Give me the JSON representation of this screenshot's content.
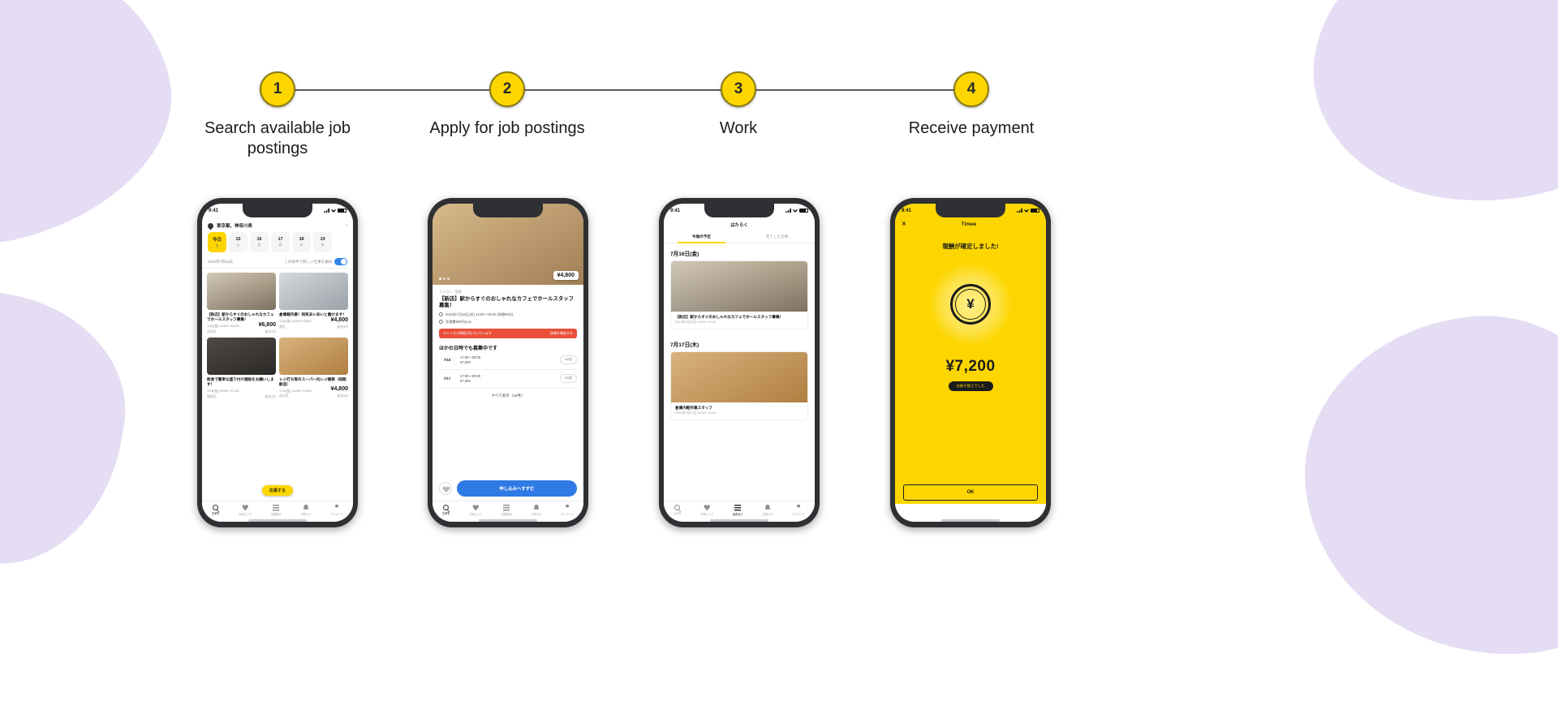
{
  "theme": {
    "accent_yellow": "#fdd600",
    "blob_purple": "#e5ddf3",
    "line_gray": "#5d5d5d",
    "cta_blue": "#2f7ae5",
    "alert_red": "#e8503a"
  },
  "stepper": {
    "steps": [
      {
        "number": "1",
        "label": "Search available job postings"
      },
      {
        "number": "2",
        "label": "Apply for job postings"
      },
      {
        "number": "3",
        "label": "Work"
      },
      {
        "number": "4",
        "label": "Receive payment"
      }
    ]
  },
  "phones": [
    {
      "name": "search-screen",
      "status": {
        "time": "9:41"
      },
      "location": "東京都、神奈川県",
      "dates": [
        {
          "day": "今日",
          "weekday": "金"
        },
        {
          "day": "15",
          "weekday": "土"
        },
        {
          "day": "16",
          "weekday": "日"
        },
        {
          "day": "17",
          "weekday": "月"
        },
        {
          "day": "18",
          "weekday": "火"
        },
        {
          "day": "19",
          "weekday": "水"
        }
      ],
      "filter_label": "2022年7月16日",
      "toggle_label": "この条件で新しい仕事を通知",
      "cards": [
        {
          "title": "【新店】駅からすぐのおしゃれなカフェでホールスタッフ募集！",
          "time": "7/16(金)\n10:00〜18:00",
          "pay": "¥6,800",
          "place": "渋谷区",
          "dist": "徒歩3分"
        },
        {
          "title": "倉庫軽作業！和気あいあいと働けます！",
          "time": "7/16(金)\n10:00〜18:00",
          "pay": "¥4,800",
          "place": "港区",
          "dist": "徒歩5分"
        },
        {
          "title": "飲食で簡単な盛り付け補助をお願いします！",
          "time": "7/16(金)\n09:00〜17:00",
          "pay": "",
          "place": "新宿区",
          "dist": "徒歩2分"
        },
        {
          "title": "レジ打ち等のスーパー内レジ業務（短期歓迎）",
          "time": "7/16(金)\n13:00〜19:00",
          "pay": "¥4,800",
          "place": "品川区",
          "dist": "徒歩8分"
        }
      ],
      "apply_pill": "応募する",
      "tabs": [
        {
          "icon": "search-icon",
          "label": "さがす",
          "active": true
        },
        {
          "icon": "heart-icon",
          "label": "お気に入り",
          "active": false
        },
        {
          "icon": "list-icon",
          "label": "応募済み",
          "active": false
        },
        {
          "icon": "bell-icon",
          "label": "お知らせ",
          "active": false
        },
        {
          "icon": "user-icon",
          "label": "マイページ",
          "active": false
        }
      ]
    },
    {
      "name": "job-detail-screen",
      "status": {
        "time": "9:41"
      },
      "hero_pay_badge": "¥4,800",
      "category": "カテゴリ：飲食",
      "title": "【新店】駅からすぐのおしゃれなカフェでホールスタッフ募集！",
      "meta_date": "2022年7月16日(金) 13:00〜19:00 (休憩60分)",
      "meta_place": "交通費500円込み",
      "alert_text": "キャンセル期限が近づいています",
      "alert_action": "詳細を確認する",
      "section_title": "ほかの日時でも募集中です",
      "slots": [
        {
          "date": "7/16",
          "weekday": "金",
          "time": "17:00〜20:00",
          "pay": "¥7,500",
          "capacity": "1/5名"
        },
        {
          "date": "7/17",
          "weekday": "土",
          "time": "17:00〜20:00",
          "pay": "¥7,500",
          "capacity": "2/5名"
        }
      ],
      "more_label": "すべて表示（16件）",
      "cta_label": "申し込みへすすむ",
      "fav_icon": "heart-icon",
      "tabs": [
        {
          "icon": "search-icon",
          "label": "さがす",
          "active": true
        },
        {
          "icon": "heart-icon",
          "label": "お気に入り",
          "active": false
        },
        {
          "icon": "list-icon",
          "label": "応募済み",
          "active": false
        },
        {
          "icon": "bell-icon",
          "label": "お知らせ",
          "active": false
        },
        {
          "icon": "user-icon",
          "label": "マイページ",
          "active": false
        }
      ]
    },
    {
      "name": "schedule-screen",
      "status": {
        "time": "9:41"
      },
      "header": "はたらく",
      "tabs_top": [
        {
          "label": "今後の予定",
          "active": true
        },
        {
          "label": "完了した仕事",
          "active": false
        }
      ],
      "groups": [
        {
          "date": "7月16日(金)",
          "card": {
            "title": "【新店】駅からすぐのおしゃれなカフェでホールスタッフ募集！",
            "meta": "2022年7月16日 13:00〜19:00"
          }
        },
        {
          "date": "7月17日(木)",
          "card": {
            "title": "倉庫内軽作業スタッフ",
            "meta": "2022年7月17日 10:00〜16:00"
          }
        }
      ],
      "tabs": [
        {
          "icon": "search-icon",
          "label": "さがす",
          "active": false
        },
        {
          "icon": "heart-icon",
          "label": "お気に入り",
          "active": false
        },
        {
          "icon": "list-icon",
          "label": "はたらく",
          "active": true
        },
        {
          "icon": "bell-icon",
          "label": "お知らせ",
          "active": false
        },
        {
          "icon": "user-icon",
          "label": "マイページ",
          "active": false
        }
      ]
    },
    {
      "name": "payment-confirmed-screen",
      "status": {
        "time": "9:41"
      },
      "close_icon": "close-icon",
      "brand": "Timee",
      "title": "報酬が確定しました!",
      "coin_symbol": "¥",
      "amount": "¥7,200",
      "chip_label": "お振り替えでした",
      "ok_label": "OK"
    }
  ]
}
